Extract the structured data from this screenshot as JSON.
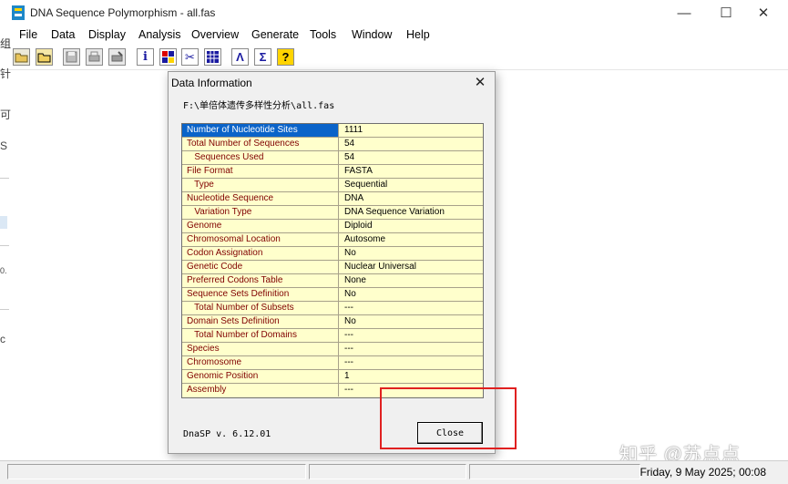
{
  "window": {
    "title": "DNA Sequence Polymorphism - all.fas",
    "minimize_glyph": "—",
    "maximize_glyph": "☐",
    "close_glyph": "✕"
  },
  "menu": [
    "File",
    "Data",
    "Display",
    "Analysis",
    "Overview",
    "Generate",
    "Tools",
    "Window",
    "Help"
  ],
  "toolbar_icons": [
    "open-folder-icon",
    "open-file-icon",
    "save-icon",
    "print-icon",
    "print-setup-icon",
    "info-icon",
    "palette-icon",
    "cut-icon",
    "grid-icon",
    "polymorphism-icon",
    "sigma-icon",
    "help-icon"
  ],
  "toolbar_glyphs": [
    "",
    "",
    "",
    "",
    "",
    "i",
    "",
    "✂",
    "",
    "Λ",
    "Σ",
    "?"
  ],
  "left_fragments": [
    "组",
    "针",
    "可",
    "S",
    "0.",
    "c"
  ],
  "dialog": {
    "title": "Data Information",
    "close_glyph": "✕",
    "path": "F:\\单倍体遗传多样性分析\\all.fas",
    "rows": [
      {
        "label": "Number of Nucleotide Sites",
        "value": "1111"
      },
      {
        "label": "Total Number of Sequences",
        "value": "54"
      },
      {
        "label": "   Sequences Used",
        "value": "54"
      },
      {
        "label": "File Format",
        "value": "FASTA"
      },
      {
        "label": "   Type",
        "value": "Sequential"
      },
      {
        "label": "Nucleotide Sequence",
        "value": "DNA"
      },
      {
        "label": "   Variation Type",
        "value": "DNA Sequence Variation"
      },
      {
        "label": "Genome",
        "value": "Diploid"
      },
      {
        "label": "Chromosomal Location",
        "value": "Autosome"
      },
      {
        "label": "Codon Assignation",
        "value": "No"
      },
      {
        "label": "Genetic Code",
        "value": "Nuclear Universal"
      },
      {
        "label": "Preferred Codons Table",
        "value": "None"
      },
      {
        "label": "Sequence Sets Definition",
        "value": "No"
      },
      {
        "label": "   Total Number of Subsets",
        "value": "---"
      },
      {
        "label": "Domain Sets Definition",
        "value": "No"
      },
      {
        "label": "   Total Number of Domains",
        "value": "---"
      },
      {
        "label": "Species",
        "value": "---"
      },
      {
        "label": "Chromosome",
        "value": "---"
      },
      {
        "label": "Genomic Position",
        "value": "1"
      },
      {
        "label": "Assembly",
        "value": "---"
      }
    ],
    "version": "DnaSP v. 6.12.01",
    "close_button": "Close"
  },
  "status": {
    "date": "Friday, 9 May 2025; 00:08"
  },
  "watermark": "知乎 @苏点点",
  "colors": {
    "grid_bg": "#ffffcc",
    "label_text": "#800000",
    "selected": "#0a63c9",
    "highlight": "#e02020"
  }
}
